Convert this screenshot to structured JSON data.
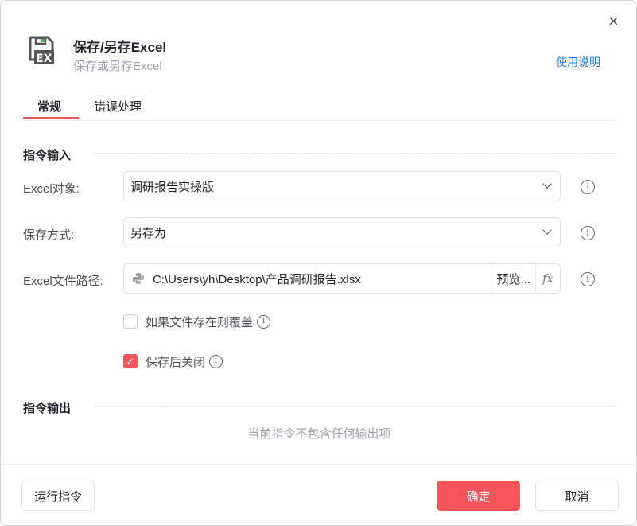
{
  "header": {
    "title": "保存/另存Excel",
    "subtitle": "保存或另存Excel",
    "help_link": "使用说明",
    "close": "×"
  },
  "tabs": [
    {
      "label": "常规",
      "active": true
    },
    {
      "label": "错误处理",
      "active": false
    }
  ],
  "input_section": {
    "title": "指令输入",
    "excel_object": {
      "label": "Excel对象:",
      "value": "调研报告实操版"
    },
    "save_mode": {
      "label": "保存方式:",
      "value": "另存为"
    },
    "file_path": {
      "label": "Excel文件路径:",
      "value": "C:\\Users\\yh\\Desktop\\产品调研报告.xlsx",
      "preview": "预览...",
      "fx": "fx"
    },
    "overwrite": {
      "label": "如果文件存在则覆盖",
      "checked": false
    },
    "close_after": {
      "label": "保存后关闭",
      "checked": true
    }
  },
  "output_section": {
    "title": "指令输出",
    "empty_text": "当前指令不包含任何输出项"
  },
  "footer": {
    "run": "运行指令",
    "ok": "确定",
    "cancel": "取消"
  },
  "colors": {
    "accent": "#f4535a",
    "link": "#1f7cf0"
  }
}
